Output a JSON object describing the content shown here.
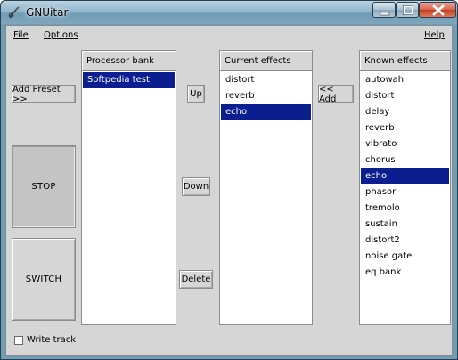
{
  "window": {
    "title": "GNUitar"
  },
  "menubar": {
    "file": "File",
    "options": "Options",
    "help": "Help"
  },
  "buttons": {
    "add_preset": "Add Preset >>",
    "stop": "STOP",
    "switch": "SWITCH",
    "up": "Up",
    "down": "Down",
    "delete": "Delete",
    "add": "<< Add"
  },
  "processor_bank": {
    "header": "Processor bank",
    "items": [
      "Softpedia test"
    ],
    "selected_index": 0
  },
  "current_effects": {
    "header": "Current effects",
    "items": [
      "distort",
      "reverb",
      "echo"
    ],
    "selected_index": 2
  },
  "known_effects": {
    "header": "Known effects",
    "items": [
      "autowah",
      "distort",
      "delay",
      "reverb",
      "vibrato",
      "chorus",
      "echo",
      "phasor",
      "tremolo",
      "sustain",
      "distort2",
      "noise gate",
      "eq bank"
    ],
    "selected_index": 6
  },
  "write_track": {
    "label": "Write track",
    "checked": false
  },
  "colors": {
    "selection": "#0a1e8f",
    "client_bg": "#d6d6d6",
    "title_gradient_mid": "#8fb6cc"
  },
  "icons": [
    "guitar-icon",
    "minimize-icon",
    "maximize-icon",
    "close-icon"
  ]
}
